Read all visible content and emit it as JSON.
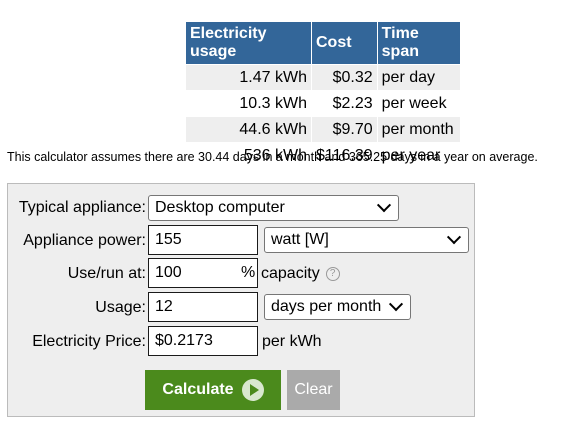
{
  "results": {
    "headers": [
      "Electricity usage",
      "Cost",
      "Time span"
    ],
    "rows": [
      {
        "usage": "1.47 kWh",
        "cost": "$0.32",
        "span": "per day"
      },
      {
        "usage": "10.3 kWh",
        "cost": "$2.23",
        "span": "per week"
      },
      {
        "usage": "44.6 kWh",
        "cost": "$9.70",
        "span": "per month"
      },
      {
        "usage": "536 kWh",
        "cost": "$116.39",
        "span": "per year"
      }
    ]
  },
  "note": "This calculator assumes there are 30.44 days in a month and 365.25 days in a year on average.",
  "form": {
    "appliance_label": "Typical appliance:",
    "appliance_value": "Desktop computer",
    "power_label": "Appliance power:",
    "power_value": "155",
    "power_unit": "watt [W]",
    "use_label": "Use/run at:",
    "use_value": "100",
    "use_suffix": "%",
    "use_capacity": "capacity",
    "help_icon": "?",
    "usage_label": "Usage:",
    "usage_value": "12",
    "usage_unit": "days per month",
    "price_label": "Electricity Price:",
    "price_value": "$0.2173",
    "price_unit": "per kWh",
    "calculate_label": "Calculate",
    "clear_label": "Clear"
  },
  "colors": {
    "header_bg": "#336699",
    "calculate_bg": "#4b8a1c",
    "clear_bg": "#aaaaaa"
  }
}
